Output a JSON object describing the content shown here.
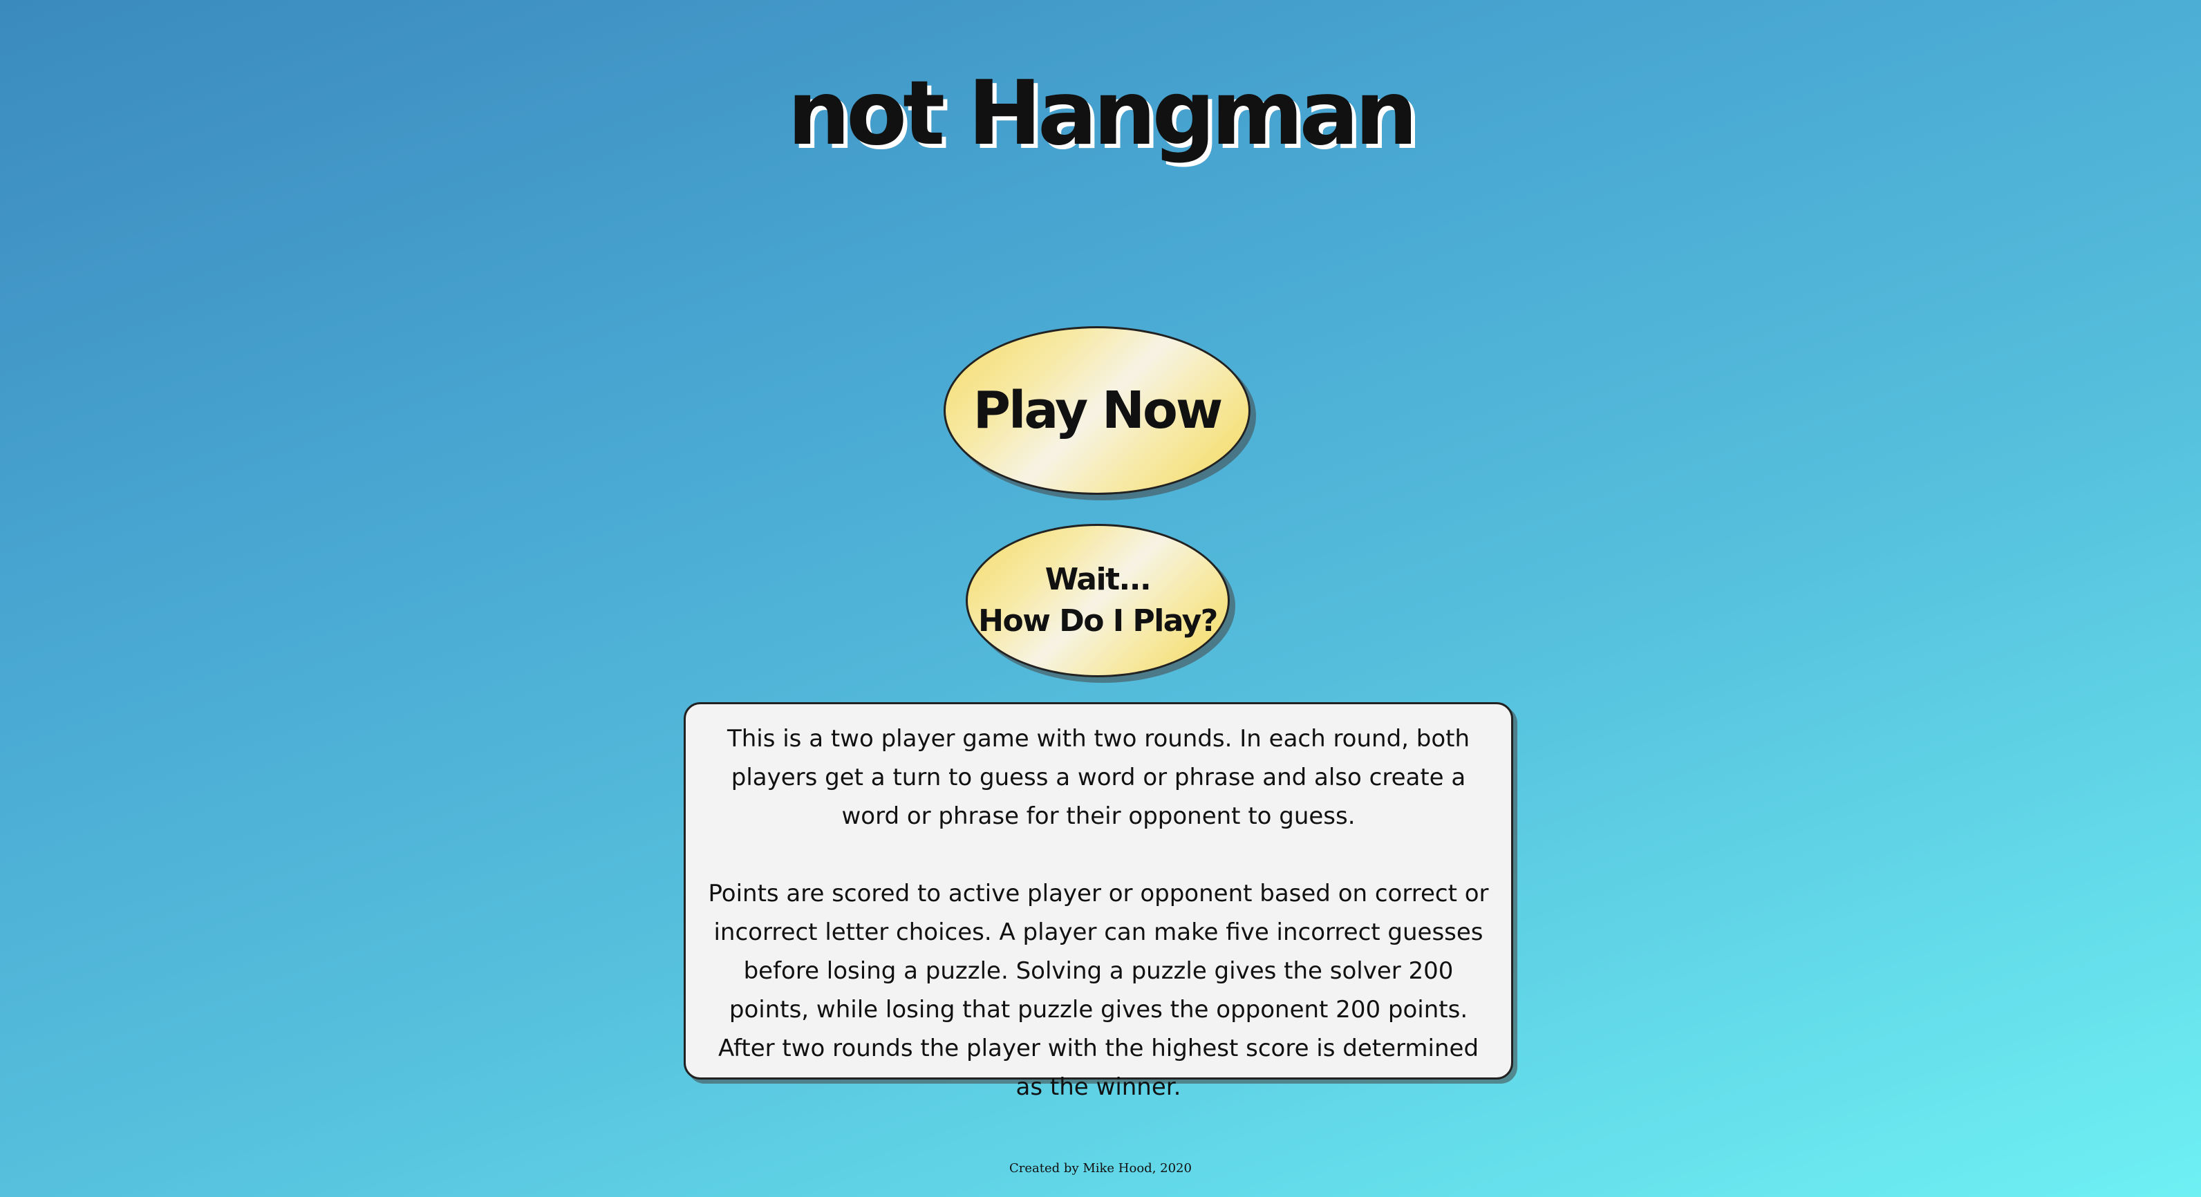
{
  "app": {
    "title": "not Hangman"
  },
  "buttons": {
    "play_label": "Play Now",
    "how_line1": "Wait...",
    "how_line2": "How Do I Play?"
  },
  "rules": {
    "paragraph1": "This is a two player game with two rounds. In each round, both players get a turn to guess a word or phrase and also create a word or phrase for their opponent to guess.",
    "paragraph2": "Points are scored to active player or opponent based on correct or incorrect letter choices. A player can make five incorrect guesses before losing a puzzle. Solving a puzzle gives the solver 200 points, while losing that puzzle gives the opponent 200 points. After two rounds the player with the highest score is determined as the winner."
  },
  "footer": {
    "credit": "Created by Mike Hood, 2020"
  },
  "colors": {
    "background_start": "#3b8abe",
    "background_end": "#6ef0f3",
    "button_yellow": "#f6dc6a",
    "panel_background": "#f3f3f3"
  }
}
